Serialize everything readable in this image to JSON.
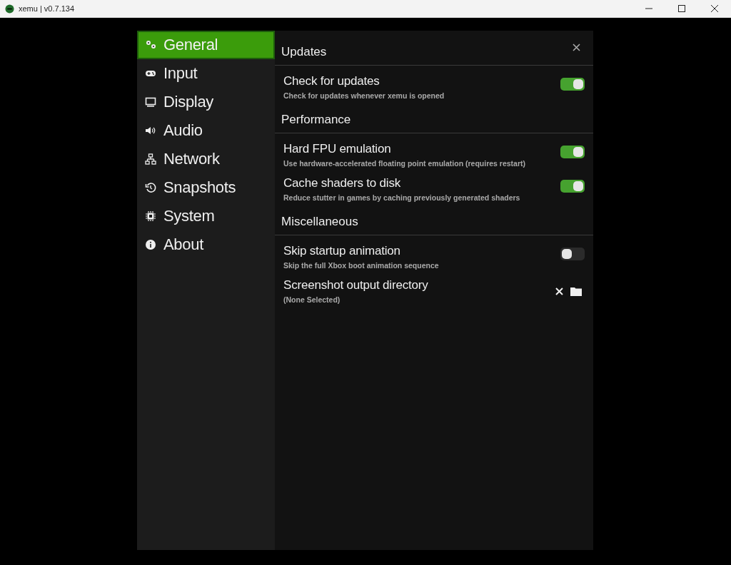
{
  "window": {
    "title": "xemu | v0.7.134"
  },
  "nav": [
    {
      "label": "General",
      "selected": true
    },
    {
      "label": "Input",
      "selected": false
    },
    {
      "label": "Display",
      "selected": false
    },
    {
      "label": "Audio",
      "selected": false
    },
    {
      "label": "Network",
      "selected": false
    },
    {
      "label": "Snapshots",
      "selected": false
    },
    {
      "label": "System",
      "selected": false
    },
    {
      "label": "About",
      "selected": false
    }
  ],
  "sections": [
    {
      "title": "Updates",
      "items": [
        {
          "kind": "toggle",
          "label": "Check for updates",
          "description": "Check for updates whenever xemu is opened",
          "on": true
        }
      ]
    },
    {
      "title": "Performance",
      "items": [
        {
          "kind": "toggle",
          "label": "Hard FPU emulation",
          "description": "Use hardware-accelerated floating point emulation (requires restart)",
          "on": true
        },
        {
          "kind": "toggle",
          "label": "Cache shaders to disk",
          "description": "Reduce stutter in games by caching previously generated shaders",
          "on": true
        }
      ]
    },
    {
      "title": "Miscellaneous",
      "items": [
        {
          "kind": "toggle",
          "label": "Skip startup animation",
          "description": "Skip the full Xbox boot animation sequence",
          "on": false
        },
        {
          "kind": "path",
          "label": "Screenshot output directory",
          "description": "(None Selected)"
        }
      ]
    }
  ]
}
